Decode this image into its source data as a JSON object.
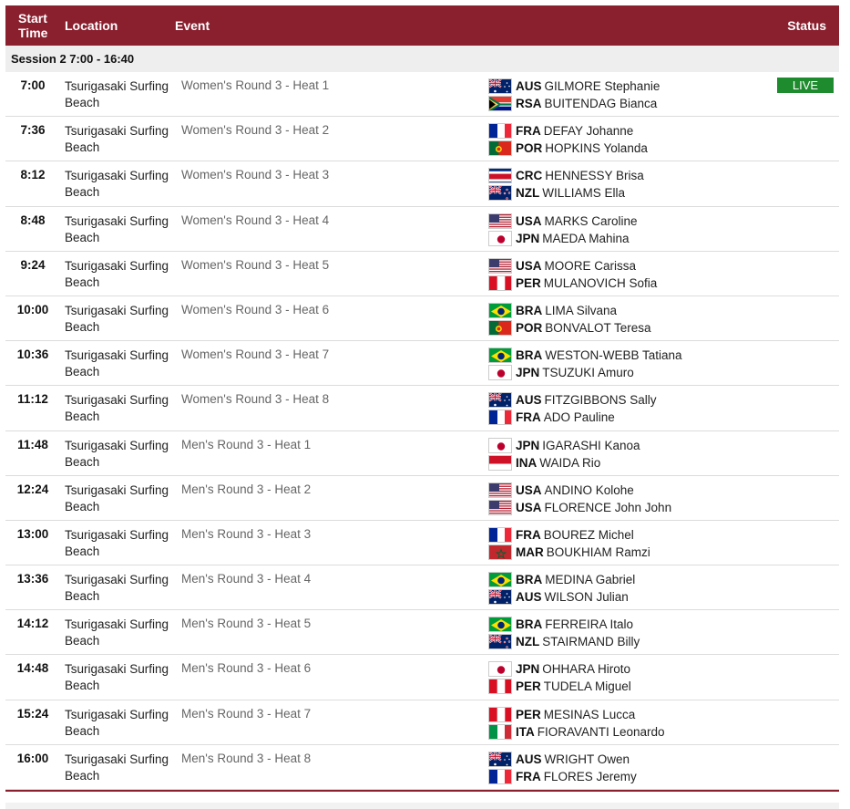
{
  "header": {
    "start_time_line1": "Start",
    "start_time_line2": "Time",
    "location": "Location",
    "event": "Event",
    "status": "Status"
  },
  "session_label": "Session 2  7:00 - 16:40",
  "rows": [
    {
      "time": "7:00",
      "loc1": "Tsurigasaki Surfing",
      "loc2": "Beach",
      "event": "Women's Round 3 - Heat 1",
      "status": "LIVE",
      "athletes": [
        {
          "flag": "aus",
          "noc": "AUS",
          "name": "GILMORE Stephanie"
        },
        {
          "flag": "rsa",
          "noc": "RSA",
          "name": "BUITENDAG Bianca"
        }
      ]
    },
    {
      "time": "7:36",
      "loc1": "Tsurigasaki Surfing",
      "loc2": "Beach",
      "event": "Women's Round 3 - Heat 2",
      "status": "",
      "athletes": [
        {
          "flag": "fra",
          "noc": "FRA",
          "name": "DEFAY Johanne"
        },
        {
          "flag": "por",
          "noc": "POR",
          "name": "HOPKINS Yolanda"
        }
      ]
    },
    {
      "time": "8:12",
      "loc1": "Tsurigasaki Surfing",
      "loc2": "Beach",
      "event": "Women's Round 3 - Heat 3",
      "status": "",
      "athletes": [
        {
          "flag": "crc",
          "noc": "CRC",
          "name": "HENNESSY Brisa"
        },
        {
          "flag": "nzl",
          "noc": "NZL",
          "name": "WILLIAMS Ella"
        }
      ]
    },
    {
      "time": "8:48",
      "loc1": "Tsurigasaki Surfing",
      "loc2": "Beach",
      "event": "Women's Round 3 - Heat 4",
      "status": "",
      "athletes": [
        {
          "flag": "usa",
          "noc": "USA",
          "name": "MARKS Caroline"
        },
        {
          "flag": "jpn",
          "noc": "JPN",
          "name": "MAEDA Mahina"
        }
      ]
    },
    {
      "time": "9:24",
      "loc1": "Tsurigasaki Surfing",
      "loc2": "Beach",
      "event": "Women's Round 3 - Heat 5",
      "status": "",
      "athletes": [
        {
          "flag": "usa",
          "noc": "USA",
          "name": "MOORE Carissa"
        },
        {
          "flag": "per",
          "noc": "PER",
          "name": "MULANOVICH Sofia"
        }
      ]
    },
    {
      "time": "10:00",
      "loc1": "Tsurigasaki Surfing",
      "loc2": "Beach",
      "event": "Women's Round 3 - Heat 6",
      "status": "",
      "athletes": [
        {
          "flag": "bra",
          "noc": "BRA",
          "name": "LIMA Silvana"
        },
        {
          "flag": "por",
          "noc": "POR",
          "name": "BONVALOT Teresa"
        }
      ]
    },
    {
      "time": "10:36",
      "loc1": "Tsurigasaki Surfing",
      "loc2": "Beach",
      "event": "Women's Round 3 - Heat 7",
      "status": "",
      "athletes": [
        {
          "flag": "bra",
          "noc": "BRA",
          "name": "WESTON-WEBB Tatiana"
        },
        {
          "flag": "jpn",
          "noc": "JPN",
          "name": "TSUZUKI Amuro"
        }
      ]
    },
    {
      "time": "11:12",
      "loc1": "Tsurigasaki Surfing",
      "loc2": "Beach",
      "event": "Women's Round 3 - Heat 8",
      "status": "",
      "athletes": [
        {
          "flag": "aus",
          "noc": "AUS",
          "name": "FITZGIBBONS Sally"
        },
        {
          "flag": "fra",
          "noc": "FRA",
          "name": "ADO Pauline"
        }
      ]
    },
    {
      "time": "11:48",
      "loc1": "Tsurigasaki Surfing",
      "loc2": "Beach",
      "event": "Men's Round 3 - Heat 1",
      "status": "",
      "athletes": [
        {
          "flag": "jpn",
          "noc": "JPN",
          "name": "IGARASHI Kanoa"
        },
        {
          "flag": "ina",
          "noc": "INA",
          "name": "WAIDA Rio"
        }
      ]
    },
    {
      "time": "12:24",
      "loc1": "Tsurigasaki Surfing",
      "loc2": "Beach",
      "event": "Men's Round 3 - Heat 2",
      "status": "",
      "athletes": [
        {
          "flag": "usa",
          "noc": "USA",
          "name": "ANDINO Kolohe"
        },
        {
          "flag": "usa",
          "noc": "USA",
          "name": "FLORENCE John John"
        }
      ]
    },
    {
      "time": "13:00",
      "loc1": "Tsurigasaki Surfing",
      "loc2": "Beach",
      "event": "Men's Round 3 - Heat 3",
      "status": "",
      "athletes": [
        {
          "flag": "fra",
          "noc": "FRA",
          "name": "BOUREZ Michel"
        },
        {
          "flag": "mar",
          "noc": "MAR",
          "name": "BOUKHIAM Ramzi"
        }
      ]
    },
    {
      "time": "13:36",
      "loc1": "Tsurigasaki Surfing",
      "loc2": "Beach",
      "event": "Men's Round 3 - Heat 4",
      "status": "",
      "athletes": [
        {
          "flag": "bra",
          "noc": "BRA",
          "name": "MEDINA Gabriel"
        },
        {
          "flag": "aus",
          "noc": "AUS",
          "name": "WILSON Julian"
        }
      ]
    },
    {
      "time": "14:12",
      "loc1": "Tsurigasaki Surfing",
      "loc2": "Beach",
      "event": "Men's Round 3 - Heat 5",
      "status": "",
      "athletes": [
        {
          "flag": "bra",
          "noc": "BRA",
          "name": "FERREIRA Italo"
        },
        {
          "flag": "nzl",
          "noc": "NZL",
          "name": "STAIRMAND Billy"
        }
      ]
    },
    {
      "time": "14:48",
      "loc1": "Tsurigasaki Surfing",
      "loc2": "Beach",
      "event": "Men's Round 3 - Heat 6",
      "status": "",
      "athletes": [
        {
          "flag": "jpn",
          "noc": "JPN",
          "name": "OHHARA Hiroto"
        },
        {
          "flag": "per",
          "noc": "PER",
          "name": "TUDELA Miguel"
        }
      ]
    },
    {
      "time": "15:24",
      "loc1": "Tsurigasaki Surfing",
      "loc2": "Beach",
      "event": "Men's Round 3 - Heat 7",
      "status": "",
      "athletes": [
        {
          "flag": "per",
          "noc": "PER",
          "name": "MESINAS Lucca"
        },
        {
          "flag": "ita",
          "noc": "ITA",
          "name": "FIORAVANTI Leonardo"
        }
      ]
    },
    {
      "time": "16:00",
      "loc1": "Tsurigasaki Surfing",
      "loc2": "Beach",
      "event": "Men's Round 3 - Heat 8",
      "status": "",
      "athletes": [
        {
          "flag": "aus",
          "noc": "AUS",
          "name": "WRIGHT Owen"
        },
        {
          "flag": "fra",
          "noc": "FRA",
          "name": "FLORES Jeremy"
        }
      ]
    }
  ],
  "colors": {
    "header_bg": "#8a1f2e",
    "live_bg": "#1e8c2e",
    "session_bg": "#eeeeee"
  }
}
